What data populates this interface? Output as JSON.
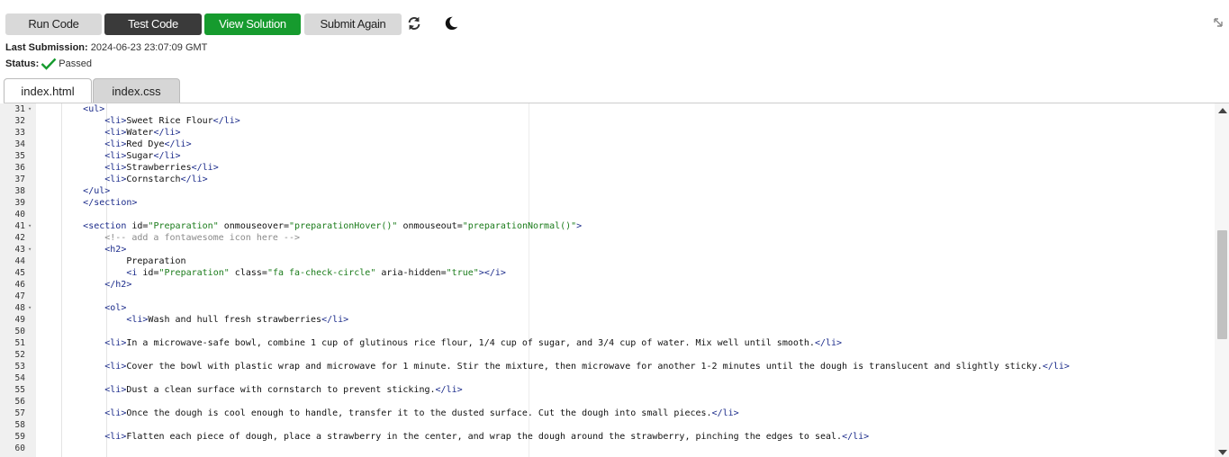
{
  "toolbar": {
    "run_label": "Run Code",
    "test_label": "Test Code",
    "view_label": "View Solution",
    "submit_label": "Submit Again",
    "refresh_icon": "refresh-icon",
    "theme_icon": "moon-icon",
    "collapse_icon": "collapse-icon"
  },
  "submission": {
    "last_label": "Last Submission:",
    "last_value": "2024-06-23 23:07:09 GMT",
    "status_label": "Status:",
    "status_value": "Passed",
    "status_color": "#169b2e"
  },
  "tabs": [
    {
      "label": "index.html",
      "active": true
    },
    {
      "label": "index.css",
      "active": false
    }
  ],
  "editor": {
    "lines": [
      {
        "n": "31",
        "fold": true
      },
      {
        "n": "32"
      },
      {
        "n": "33"
      },
      {
        "n": "34"
      },
      {
        "n": "35"
      },
      {
        "n": "36"
      },
      {
        "n": "37"
      },
      {
        "n": "38"
      },
      {
        "n": "39"
      },
      {
        "n": "40"
      },
      {
        "n": "41",
        "fold": true
      },
      {
        "n": "42"
      },
      {
        "n": "43",
        "fold": true
      },
      {
        "n": "44"
      },
      {
        "n": "45"
      },
      {
        "n": "46"
      },
      {
        "n": "47"
      },
      {
        "n": "48",
        "fold": true
      },
      {
        "n": "49"
      },
      {
        "n": "50"
      },
      {
        "n": "51"
      },
      {
        "n": "52"
      },
      {
        "n": "53"
      },
      {
        "n": "54"
      },
      {
        "n": "55"
      },
      {
        "n": "56"
      },
      {
        "n": "57"
      },
      {
        "n": "58"
      },
      {
        "n": "59"
      },
      {
        "n": "60"
      }
    ],
    "code": [
      "        <ul>",
      "            <li>Sweet Rice Flour</li>",
      "            <li>Water</li>",
      "            <li>Red Dye</li>",
      "            <li>Sugar</li>",
      "            <li>Strawberries</li>",
      "            <li>Cornstarch</li>",
      "        </ul>",
      "        </section>",
      "",
      "        <section id=\"Preparation\" onmouseover=\"preparationHover()\" onmouseout=\"preparationNormal()\">",
      "            <!-- add a fontawesome icon here -->",
      "            <h2>",
      "                Preparation",
      "                <i id=\"Preparation\" class=\"fa fa-check-circle\" aria-hidden=\"true\"></i>",
      "            </h2>",
      "",
      "            <ol>",
      "                <li>Wash and hull fresh strawberries</li>",
      "",
      "            <li>In a microwave-safe bowl, combine 1 cup of glutinous rice flour, 1/4 cup of sugar, and 3/4 cup of water. Mix well until smooth.</li>",
      "",
      "            <li>Cover the bowl with plastic wrap and microwave for 1 minute. Stir the mixture, then microwave for another 1-2 minutes until the dough is translucent and slightly sticky.</li>",
      "",
      "            <li>Dust a clean surface with cornstarch to prevent sticking.</li>",
      "",
      "            <li>Once the dough is cool enough to handle, transfer it to the dusted surface. Cut the dough into small pieces.</li>",
      "",
      "            <li>Flatten each piece of dough, place a strawberry in the center, and wrap the dough around the strawberry, pinching the edges to seal.</li>",
      ""
    ]
  }
}
